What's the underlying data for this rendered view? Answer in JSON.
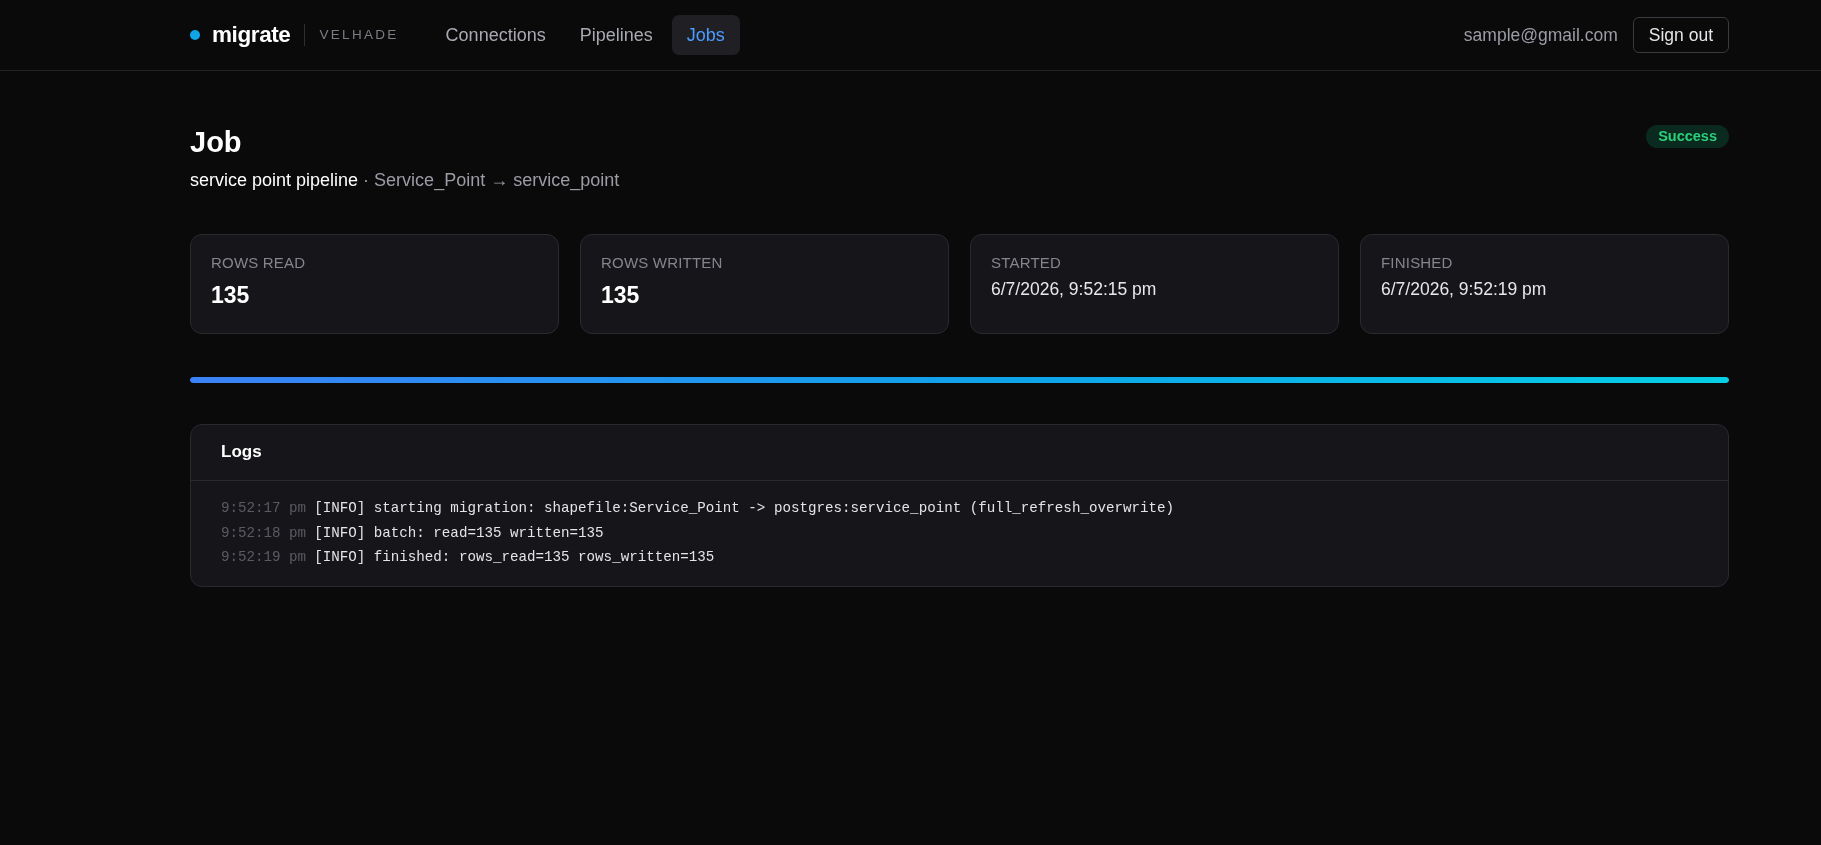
{
  "brand": {
    "name": "migrate",
    "org": "VELHADE"
  },
  "nav": [
    {
      "label": "Connections",
      "selected": false
    },
    {
      "label": "Pipelines",
      "selected": false
    },
    {
      "label": "Jobs",
      "selected": true
    }
  ],
  "user": {
    "email": "sample@gmail.com",
    "sign_out": "Sign out"
  },
  "job": {
    "title": "Job",
    "pipeline": "service point pipeline",
    "route": "· Service_Point → service_point",
    "status": {
      "label": "Success",
      "kind": "success"
    }
  },
  "stats": [
    {
      "label": "ROWS READ",
      "value": "135",
      "kind": "count"
    },
    {
      "label": "ROWS WRITTEN",
      "value": "135",
      "kind": "count"
    },
    {
      "label": "STARTED",
      "value": "6/7/2026, 9:52:15 pm",
      "kind": "time"
    },
    {
      "label": "FINISHED",
      "value": "6/7/2026, 9:52:19 pm",
      "kind": "time"
    }
  ],
  "progress": {
    "level": 1
  },
  "logs": {
    "title": "Logs",
    "lines": [
      {
        "time": "9:52:17 pm",
        "message": "[INFO] starting migration: shapefile:Service_Point -> postgres:service_point (full_refresh_overwrite)"
      },
      {
        "time": "9:52:18 pm",
        "message": "[INFO] batch: read=135 written=135"
      },
      {
        "time": "9:52:19 pm",
        "message": "[INFO] finished: rows_read=135 rows_written=135"
      }
    ]
  }
}
